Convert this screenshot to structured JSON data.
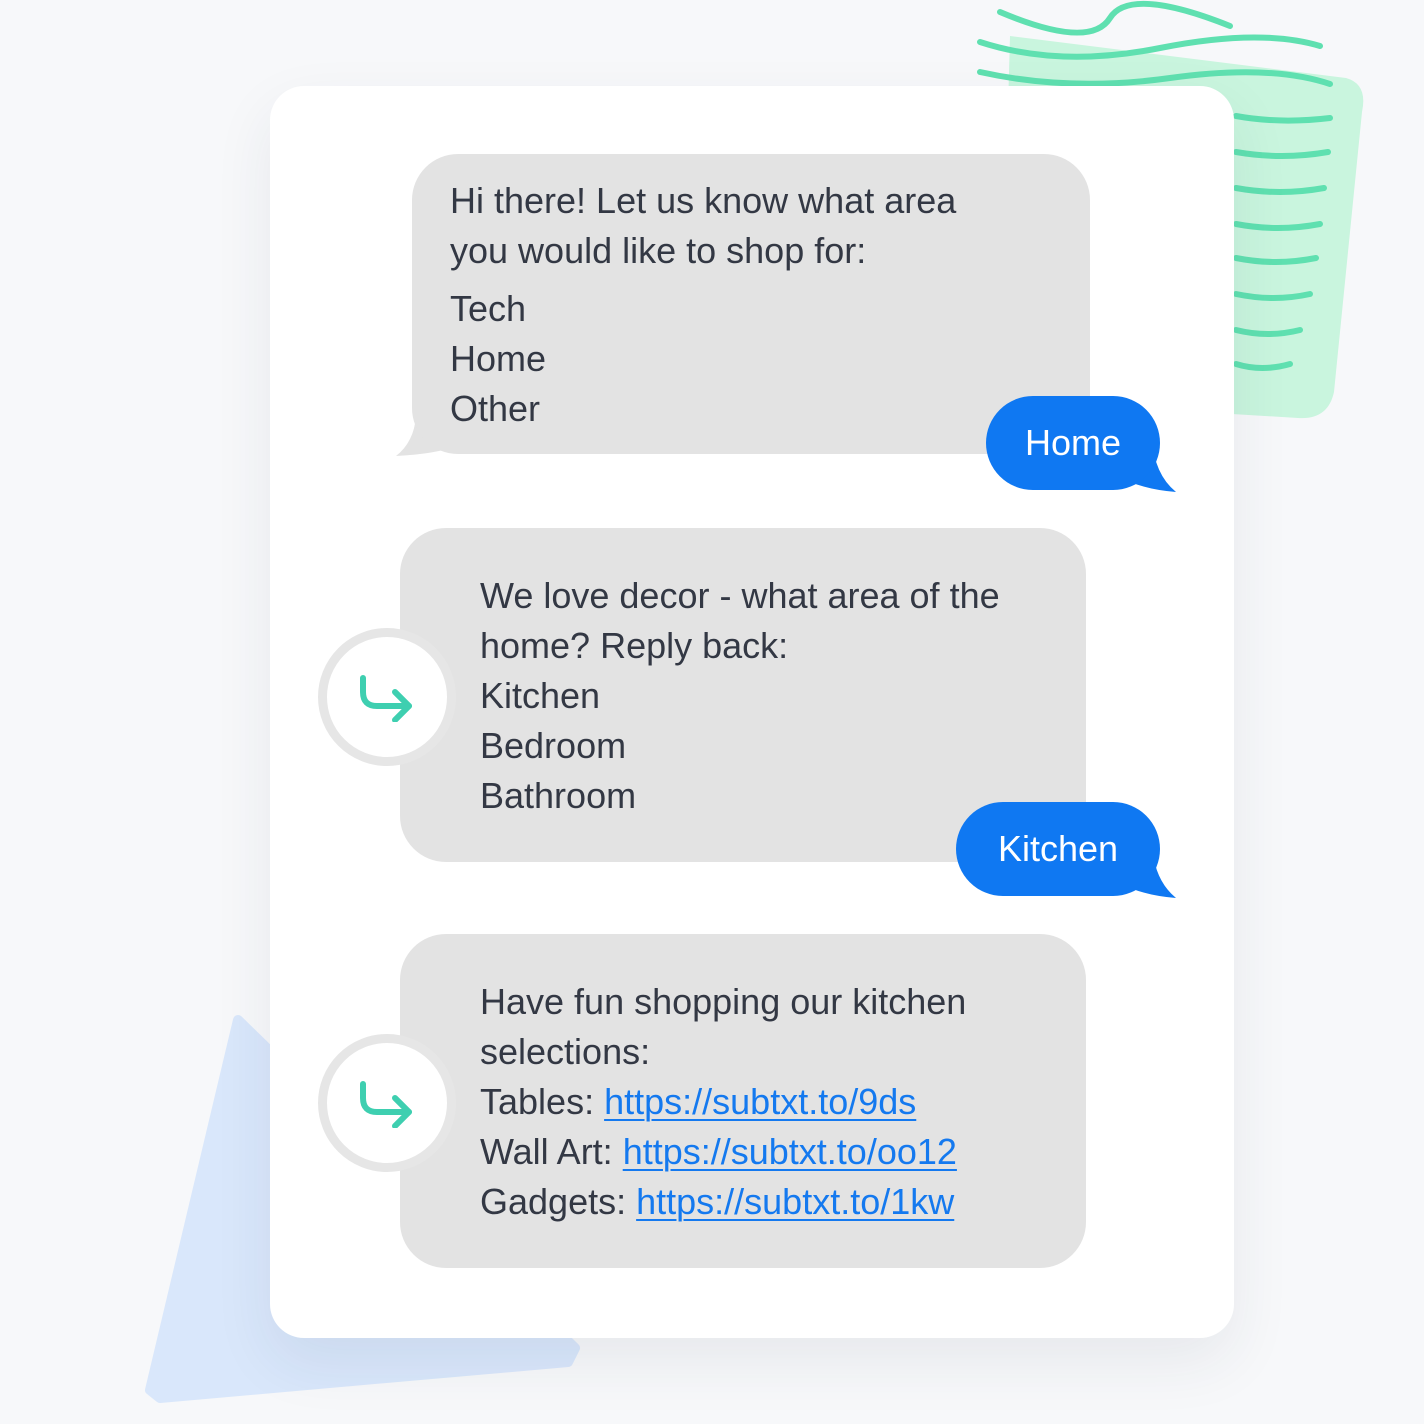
{
  "conversation": {
    "message1": {
      "intro": "Hi there! Let us know what area you would like to shop for:",
      "options": [
        "Tech",
        "Home",
        "Other"
      ]
    },
    "reply1": "Home",
    "message2": {
      "intro": "We love decor - what area of the home? Reply back:",
      "options": [
        "Kitchen",
        "Bedroom",
        "Bathroom"
      ]
    },
    "reply2": "Kitchen",
    "message3": {
      "intro": "Have fun shopping our kitchen selections:",
      "links": [
        {
          "label": "Tables:",
          "url": "https://subtxt.to/9ds"
        },
        {
          "label": "Wall Art:",
          "url": "https://subtxt.to/oo12"
        },
        {
          "label": "Gadgets:",
          "url": "https://subtxt.to/1kw"
        }
      ]
    }
  },
  "colors": {
    "incoming_bubble": "#e3e3e3",
    "outgoing_bubble": "#0f78f2",
    "link": "#1479ef",
    "reply_arrow": "#3ecfb0",
    "decor_green": "#c9f5de",
    "decor_blue": "#d9e7fb"
  },
  "icons": [
    "reply-arrow-icon"
  ]
}
